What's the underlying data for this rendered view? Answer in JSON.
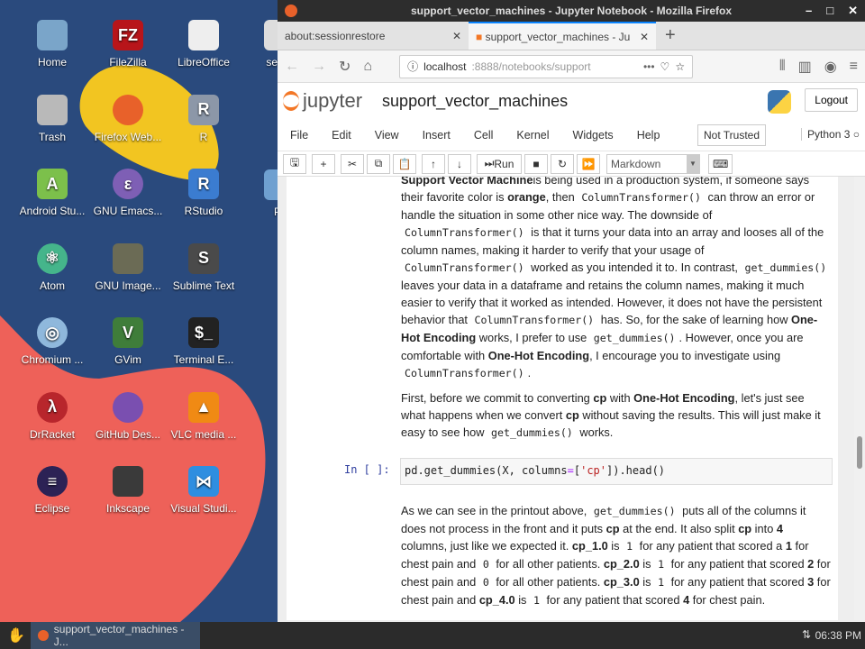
{
  "desktop": {
    "icons": [
      {
        "label": "Home",
        "color": "#7aa5c9",
        "glyph": ""
      },
      {
        "label": "FileZilla",
        "color": "#b8151a",
        "glyph": "FZ"
      },
      {
        "label": "LibreOffice",
        "color": "#eeeeee",
        "glyph": ""
      },
      {
        "label": "Trash",
        "color": "#b9b9b9",
        "glyph": ""
      },
      {
        "label": "Firefox Web...",
        "color": "#e8612a",
        "glyph": ""
      },
      {
        "label": "R",
        "color": "#8c97a8",
        "glyph": "R"
      },
      {
        "label": "Android Stu...",
        "color": "#7cc04b",
        "glyph": "A"
      },
      {
        "label": "GNU Emacs...",
        "color": "#7e5fb5",
        "glyph": "ε"
      },
      {
        "label": "RStudio",
        "color": "#3b7cd0",
        "glyph": "R"
      },
      {
        "label": "Atom",
        "color": "#45b58b",
        "glyph": "⚛"
      },
      {
        "label": "GNU Image...",
        "color": "#6b6b55",
        "glyph": ""
      },
      {
        "label": "Sublime Text",
        "color": "#4a4a4a",
        "glyph": "S"
      },
      {
        "label": "Chromium ...",
        "color": "#8fb8dc",
        "glyph": "◎"
      },
      {
        "label": "GVim",
        "color": "#3f7d3a",
        "glyph": "V"
      },
      {
        "label": "Terminal E...",
        "color": "#222222",
        "glyph": "$_"
      },
      {
        "label": "DrRacket",
        "color": "#b8262c",
        "glyph": "λ"
      },
      {
        "label": "GitHub Des...",
        "color": "#7a4fb0",
        "glyph": ""
      },
      {
        "label": "VLC media ...",
        "color": "#f08a14",
        "glyph": "▲"
      },
      {
        "label": "Eclipse",
        "color": "#2c2255",
        "glyph": "≡"
      },
      {
        "label": "Inkscape",
        "color": "#3a3a3a",
        "glyph": ""
      },
      {
        "label": "Visual Studi...",
        "color": "#2f8ee0",
        "glyph": "⋈"
      }
    ],
    "partial": [
      {
        "label": "setup"
      },
      {
        "label": "Pr"
      }
    ]
  },
  "window": {
    "title": "support_vector_machines - Jupyter Notebook - Mozilla Firefox"
  },
  "tabs": [
    {
      "label": "about:sessionrestore"
    },
    {
      "label": "support_vector_machines - Ju"
    }
  ],
  "url": {
    "host": "localhost",
    "rest": ":8888/notebooks/support"
  },
  "jupyter": {
    "logo": "jupyter",
    "notebook_name": "support_vector_machines",
    "logout": "Logout",
    "menu": [
      "File",
      "Edit",
      "View",
      "Insert",
      "Cell",
      "Kernel",
      "Widgets",
      "Help"
    ],
    "trust": "Not Trusted",
    "kernel": "Python 3",
    "run": "Run",
    "cell_type": "Markdown"
  },
  "cells": {
    "p1": [
      [
        "b",
        "Support Vector Machine"
      ],
      [
        "",
        "is being used in a production system, if someone says their favorite color is "
      ],
      [
        "b",
        "orange"
      ],
      [
        "",
        ", then "
      ],
      [
        "c",
        "ColumnTransformer()"
      ],
      [
        "",
        " can throw an error or handle the situation in some other nice way. The downside of "
      ],
      [
        "c",
        "ColumnTransformer()"
      ],
      [
        "",
        " is that it turns your data into an array and looses all of the column names, making it harder to verify that your usage of "
      ],
      [
        "c",
        "ColumnTransformer()"
      ],
      [
        "",
        " worked as you intended it to. In contrast, "
      ],
      [
        "c",
        "get_dummies()"
      ],
      [
        "",
        " leaves your data in a dataframe and retains the column names, making it much easier to verify that it worked as intended. However, it does not have the persistent behavior that "
      ],
      [
        "c",
        "ColumnTransformer()"
      ],
      [
        "",
        " has. So, for the sake of learning how "
      ],
      [
        "b",
        "One-Hot Encoding"
      ],
      [
        "",
        " works, I prefer to use "
      ],
      [
        "c",
        "get_dummies()"
      ],
      [
        "",
        ". However, once you are comfortable with "
      ],
      [
        "b",
        "One-Hot Encoding"
      ],
      [
        "",
        ", I encourage you to investigate using "
      ],
      [
        "c",
        "ColumnTransformer()"
      ],
      [
        "",
        "."
      ]
    ],
    "p2": [
      [
        "",
        "First, before we commit to converting "
      ],
      [
        "b",
        "cp"
      ],
      [
        "",
        " with "
      ],
      [
        "b",
        "One-Hot Encoding"
      ],
      [
        "",
        ", let's just see what happens when we convert "
      ],
      [
        "b",
        "cp"
      ],
      [
        "",
        " without saving the results. This will just make it easy to see how "
      ],
      [
        "c",
        "get_dummies()"
      ],
      [
        "",
        " works."
      ]
    ],
    "code": {
      "prompt": "In [ ]:",
      "a": "pd.get_dummies(X, columns",
      "op": "=",
      "b": "[",
      "s": "'cp'",
      "c": "]).head()"
    },
    "p3": [
      [
        "",
        "As we can see in the printout above, "
      ],
      [
        "c",
        "get_dummies()"
      ],
      [
        "",
        " puts all of the columns it does not process in the front and it puts "
      ],
      [
        "b",
        "cp"
      ],
      [
        "",
        " at the end. It also split "
      ],
      [
        "b",
        "cp"
      ],
      [
        "",
        " into "
      ],
      [
        "b",
        "4"
      ],
      [
        "",
        " columns, just like we expected it. "
      ],
      [
        "b",
        "cp_1.0"
      ],
      [
        "",
        " is "
      ],
      [
        "c",
        "1"
      ],
      [
        "",
        " for any patient that scored a "
      ],
      [
        "b",
        "1"
      ],
      [
        "",
        " for chest pain and "
      ],
      [
        "c",
        "0"
      ],
      [
        "",
        " for all other patients. "
      ],
      [
        "b",
        "cp_2.0"
      ],
      [
        "",
        " is "
      ],
      [
        "c",
        "1"
      ],
      [
        "",
        " for any patient that scored "
      ],
      [
        "b",
        "2"
      ],
      [
        "",
        " for chest pain and "
      ],
      [
        "c",
        "0"
      ],
      [
        "",
        " for all other patients. "
      ],
      [
        "b",
        "cp_3.0"
      ],
      [
        "",
        " is "
      ],
      [
        "c",
        "1"
      ],
      [
        "",
        " for any patient that scored "
      ],
      [
        "b",
        "3"
      ],
      [
        "",
        " for chest pain and "
      ],
      [
        "b",
        "cp_4.0"
      ],
      [
        "",
        " is "
      ],
      [
        "c",
        "1"
      ],
      [
        "",
        " for any patient that scored "
      ],
      [
        "b",
        "4"
      ],
      [
        "",
        " for chest pain."
      ]
    ]
  },
  "taskbar": {
    "task": "support_vector_machines - J...",
    "clock": "06:38 PM"
  }
}
